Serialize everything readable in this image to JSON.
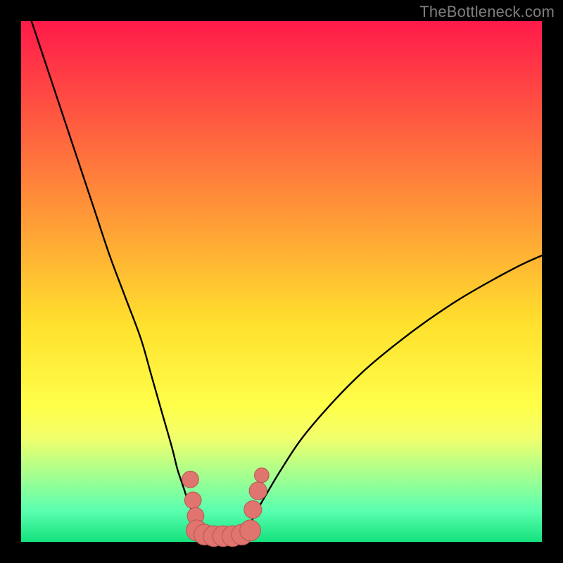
{
  "watermark": "TheBottleneck.com",
  "colors": {
    "frame": "#000000",
    "gradient_top": "#ff1a4a",
    "gradient_bottom": "#14e27d",
    "curve": "#000000",
    "marker_fill": "#e0746f",
    "marker_stroke": "#b8564f"
  },
  "chart_data": {
    "type": "line",
    "title": "",
    "xlabel": "",
    "ylabel": "",
    "xlim": [
      0,
      100
    ],
    "ylim": [
      0,
      100
    ],
    "grid": false,
    "legend": false,
    "series": [
      {
        "name": "left-curve",
        "x": [
          2,
          5,
          8,
          11,
          14,
          17,
          20,
          23,
          25,
          27,
          29,
          30,
          31,
          32,
          33,
          34,
          35,
          36
        ],
        "y": [
          100,
          91,
          82,
          73,
          64,
          55,
          47,
          39,
          32,
          25,
          18,
          14,
          11,
          8,
          5.5,
          3.5,
          2,
          1
        ]
      },
      {
        "name": "right-curve",
        "x": [
          42,
          43,
          44,
          45,
          47,
          50,
          54,
          60,
          66,
          72,
          78,
          84,
          90,
          96,
          100
        ],
        "y": [
          1,
          2,
          3.5,
          5.5,
          9,
          14,
          20,
          27,
          33,
          38,
          42.5,
          46.5,
          50,
          53.2,
          55
        ]
      },
      {
        "name": "valley-floor",
        "x": [
          36,
          42
        ],
        "y": [
          1,
          1
        ]
      }
    ],
    "markers": [
      {
        "x": 32.5,
        "y": 12.0,
        "r": 1.6
      },
      {
        "x": 33.0,
        "y": 8.0,
        "r": 1.6
      },
      {
        "x": 33.5,
        "y": 5.0,
        "r": 1.6
      },
      {
        "x": 33.7,
        "y": 2.2,
        "r": 2.0
      },
      {
        "x": 35.2,
        "y": 1.4,
        "r": 2.0
      },
      {
        "x": 37.0,
        "y": 1.1,
        "r": 2.0
      },
      {
        "x": 38.8,
        "y": 1.1,
        "r": 2.0
      },
      {
        "x": 40.6,
        "y": 1.1,
        "r": 2.0
      },
      {
        "x": 42.4,
        "y": 1.4,
        "r": 2.0
      },
      {
        "x": 44.0,
        "y": 2.2,
        "r": 2.0
      },
      {
        "x": 44.5,
        "y": 6.2,
        "r": 1.7
      },
      {
        "x": 45.5,
        "y": 9.8,
        "r": 1.7
      },
      {
        "x": 46.2,
        "y": 12.8,
        "r": 1.4
      }
    ]
  }
}
